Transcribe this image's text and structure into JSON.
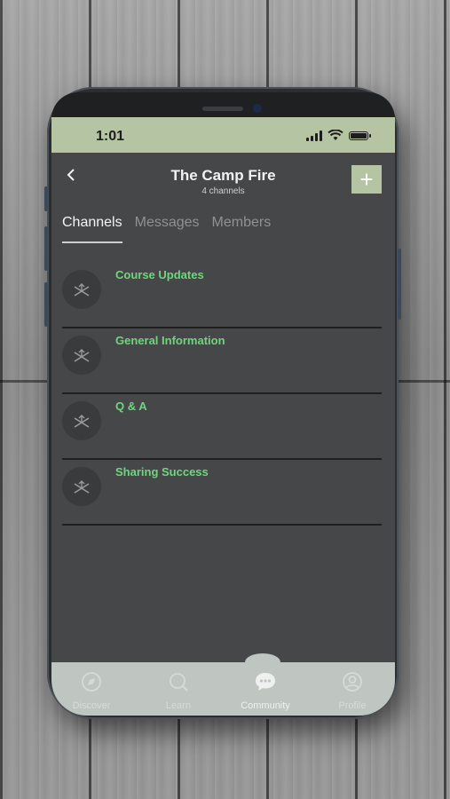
{
  "status_bar": {
    "time": "1:01"
  },
  "header": {
    "back_icon": "chevron-left-icon",
    "title": "The Camp Fire",
    "subtitle": "4 channels",
    "add_label": "+"
  },
  "tabs": [
    {
      "label": "Channels",
      "active": true
    },
    {
      "label": "Messages",
      "active": false
    },
    {
      "label": "Members",
      "active": false
    }
  ],
  "channels": [
    {
      "name": "Course Updates",
      "icon": "campfire-icon"
    },
    {
      "name": "General Information",
      "icon": "campfire-icon"
    },
    {
      "name": "Q & A",
      "icon": "campfire-icon"
    },
    {
      "name": "Sharing Success",
      "icon": "campfire-icon"
    }
  ],
  "bottom_nav": [
    {
      "label": "Discover",
      "icon": "compass-icon",
      "active": false
    },
    {
      "label": "Learn",
      "icon": "search-icon",
      "active": false
    },
    {
      "label": "Community",
      "icon": "chat-bubble-icon",
      "active": true
    },
    {
      "label": "Profile",
      "icon": "user-icon",
      "active": false
    }
  ],
  "colors": {
    "accent_green": "#6fd67d",
    "header_sage": "#b5c4a3",
    "screen_bg": "#464748",
    "nav_bg": "#bfc6c2"
  }
}
